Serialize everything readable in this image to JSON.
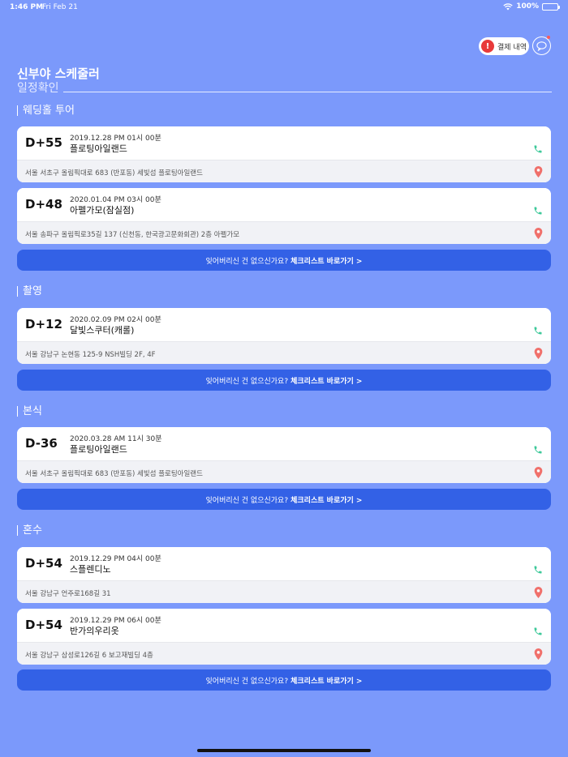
{
  "status_bar": {
    "time": "1:46 PM",
    "date": "Fri Feb 21",
    "battery": "100%"
  },
  "header": {
    "pay_label": "결제 내역",
    "alert_icon": "!",
    "chat_icon": "chat-bubble-icon",
    "app_title": "신부야 스케줄러",
    "page_subtitle": "일정확인"
  },
  "checklist": {
    "prefix": "잊어버리신 건 없으신가요?",
    "link": "체크리스트 바로가기 >"
  },
  "sections": [
    {
      "title": "웨딩홀 투어",
      "cards": [
        {
          "dday": "D+55",
          "datetime": "2019.12.28 PM 01시 00분",
          "place": "플로팅아일랜드",
          "address": "서울 서초구 올림픽대로 683 (반포동) 세빛섬 플로팅아일랜드"
        },
        {
          "dday": "D+48",
          "datetime": "2020.01.04 PM 03시 00분",
          "place": "아펠가모(잠실점)",
          "address": "서울 송파구 올림픽로35길 137 (신천동, 한국광고문화회관) 2층 아펠가모"
        }
      ]
    },
    {
      "title": "촬영",
      "cards": [
        {
          "dday": "D+12",
          "datetime": "2020.02.09 PM 02시 00분",
          "place": "달빛스쿠터(캐롤)",
          "address": "서울 강남구 논현동 125-9 NSH빌딩 2F, 4F"
        }
      ]
    },
    {
      "title": "본식",
      "cards": [
        {
          "dday": "D-36",
          "datetime": "2020.03.28 AM 11시 30분",
          "place": "플로팅아일랜드",
          "address": "서울 서초구 올림픽대로 683 (반포동) 세빛섬 플로팅아일랜드"
        }
      ]
    },
    {
      "title": "혼수",
      "cards": [
        {
          "dday": "D+54",
          "datetime": "2019.12.29 PM 04시 00분",
          "place": "스플렌디노",
          "address": "서울 강남구 언주로168길 31"
        },
        {
          "dday": "D+54",
          "datetime": "2019.12.29 PM 06시 00분",
          "place": "반가의우리옷",
          "address": "서울 강남구 삼성로126길 6 보고재빌딩 4층"
        }
      ]
    }
  ],
  "colors": {
    "background": "#7b99fb",
    "button": "#3361e6",
    "phone_icon": "#3ec99a",
    "pin_icon": "#f0706b",
    "alert": "#e83a3a"
  }
}
